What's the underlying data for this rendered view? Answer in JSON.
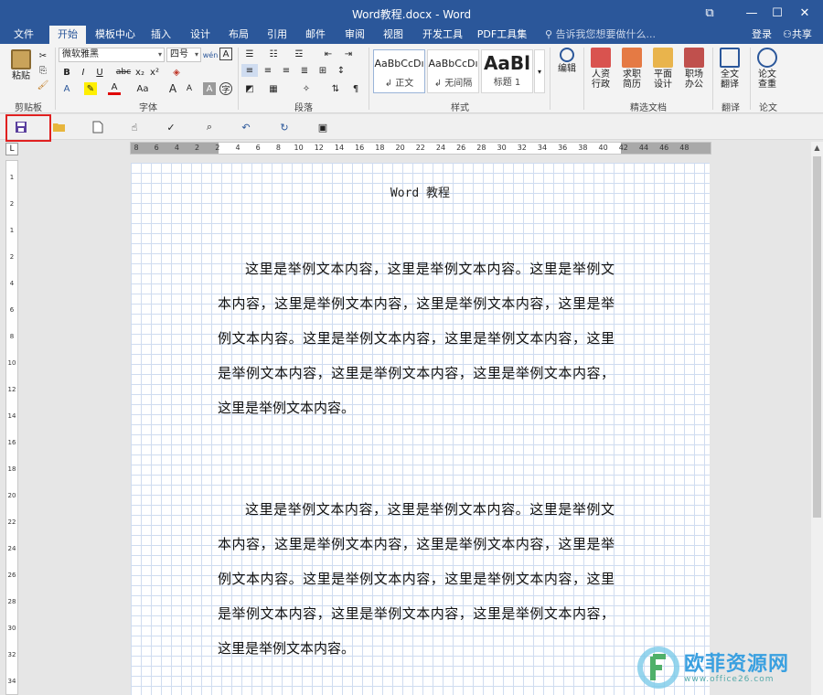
{
  "window": {
    "title": "Word教程.docx - Word",
    "controls": {
      "ribbon_display": "⧉",
      "minimize": "—",
      "maximize": "☐",
      "close": "✕"
    }
  },
  "tabs": [
    {
      "label": "文件"
    },
    {
      "label": "开始"
    },
    {
      "label": "模板中心"
    },
    {
      "label": "插入"
    },
    {
      "label": "设计"
    },
    {
      "label": "布局"
    },
    {
      "label": "引用"
    },
    {
      "label": "邮件"
    },
    {
      "label": "审阅"
    },
    {
      "label": "视图"
    },
    {
      "label": "开发工具"
    },
    {
      "label": "PDF工具集"
    }
  ],
  "active_tab": "开始",
  "tell_me": "告诉我您想要做什么...",
  "login": "登录",
  "share": "共享",
  "ribbon": {
    "clipboard": {
      "paste": "粘贴",
      "label": "剪贴板"
    },
    "font": {
      "name": "微软雅黑",
      "size": "四号",
      "label": "字体",
      "buttons": {
        "bold": "B",
        "italic": "I",
        "underline": "U",
        "strike": "abc",
        "sub": "x₂",
        "sup": "x²",
        "grow": "A",
        "shrink": "A",
        "case": "Aa",
        "wen": "wén",
        "a_box": "A",
        "fontcolor": "A"
      }
    },
    "paragraph": {
      "label": "段落"
    },
    "styles": {
      "label": "样式",
      "items": [
        {
          "sample": "AaBbCcDı",
          "name": "↲ 正文"
        },
        {
          "sample": "AaBbCcDı",
          "name": "↲ 无间隔"
        },
        {
          "sample": "AaBl",
          "name": "标题 1"
        }
      ]
    },
    "editing": {
      "label": "编辑"
    },
    "featured": {
      "label": "精选文档",
      "items": [
        {
          "l1": "人资",
          "l2": "行政"
        },
        {
          "l1": "求职",
          "l2": "简历"
        },
        {
          "l1": "平面",
          "l2": "设计"
        },
        {
          "l1": "职场",
          "l2": "办公"
        }
      ]
    },
    "translate": {
      "l1": "全文",
      "l2": "翻译",
      "label": "翻译"
    },
    "paper": {
      "l1": "论文",
      "l2": "查重",
      "label": "论文"
    }
  },
  "ruler": {
    "h_ticks": [
      "8",
      "6",
      "4",
      "2",
      "2",
      "4",
      "6",
      "8",
      "10",
      "12",
      "14",
      "16",
      "18",
      "20",
      "22",
      "24",
      "26",
      "28",
      "30",
      "32",
      "34",
      "36",
      "38",
      "40",
      "42",
      "44",
      "46",
      "48"
    ],
    "v_ticks": [
      "1",
      "2",
      "1",
      "2",
      "4",
      "6",
      "8",
      "10",
      "12",
      "14",
      "16",
      "18",
      "20",
      "22",
      "24",
      "26",
      "28",
      "30",
      "32",
      "34"
    ],
    "corner": "L"
  },
  "document": {
    "title": "Word 教程",
    "paragraphs": [
      "这里是举例文本内容，这里是举例文本内容。这里是举例文本内容，这里是举例文本内容，这里是举例文本内容，这里是举例文本内容。这里是举例文本内容，这里是举例文本内容，这里是举例文本内容，这里是举例文本内容，这里是举例文本内容，这里是举例文本内容。",
      "这里是举例文本内容，这里是举例文本内容。这里是举例文本内容，这里是举例文本内容，这里是举例文本内容，这里是举例文本内容。这里是举例文本内容，这里是举例文本内容，这里是举例文本内容，这里是举例文本内容，这里是举例文本内容，这里是举例文本内容。"
    ]
  },
  "watermark": {
    "brand": "欧菲资源网",
    "url": "www.office26.com"
  },
  "colors": {
    "accent": "#2b579a",
    "highlight": "#e02020"
  }
}
